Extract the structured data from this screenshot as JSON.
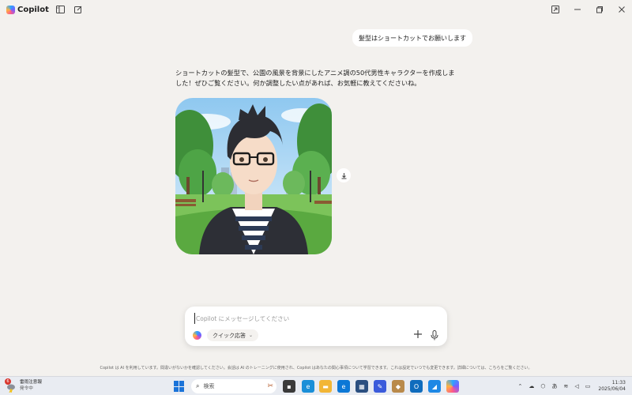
{
  "app": {
    "title": "Copilot"
  },
  "chat": {
    "user_message": "髪型はショートカットでお願いします",
    "assistant_reply": "ショートカットの髪型で、公園の風景を背景にしたアニメ調の50代男性キャラクターを作成しました！ぜひご覧ください。何か調整したい点があれば、お気軽に教えてくださいね。"
  },
  "composer": {
    "placeholder": "Copilot にメッセージしてください",
    "mode_label": "クイック応答"
  },
  "disclaimer": "Copilot は AI を利用しています。間違いがないかを確認してください。会話は AI のトレーニングに使用され、Copilot はあなたの関心事項について学習できます。これは設定でいつでも変更できます。詳細については、こちらをご覧ください。",
  "taskbar": {
    "weather_title": "雷雨注意報",
    "weather_sub": "発令中",
    "weather_badge": "6",
    "search_label": "検索",
    "ime": "あ",
    "time": "11:33",
    "date": "2025/06/04"
  },
  "icons": [
    "copilot-logo",
    "sidebar-icon",
    "new-chat-icon",
    "pop-out-icon",
    "minimize-icon",
    "restore-icon",
    "close-icon",
    "download-icon",
    "plus-icon",
    "mic-icon",
    "chevron-down-icon"
  ]
}
